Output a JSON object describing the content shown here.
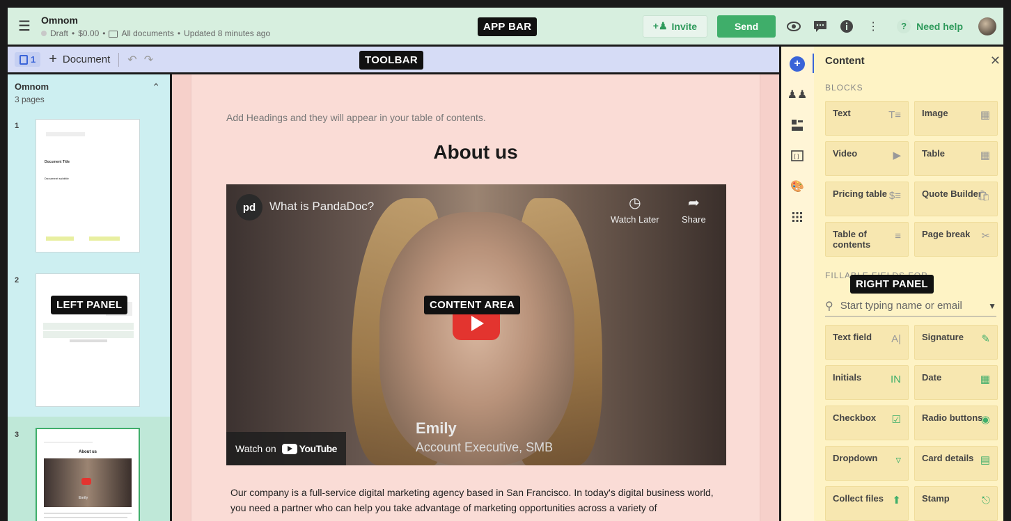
{
  "appbar": {
    "tag": "APP BAR",
    "doc_title": "Omnom",
    "status": "Draft",
    "price": "$0.00",
    "folder": "All documents",
    "updated": "Updated 8 minutes ago",
    "invite_label": "Invite",
    "send_label": "Send",
    "help_label": "Need help"
  },
  "toolbar": {
    "tag": "TOOLBAR",
    "pages_count": "1",
    "add_document_label": "Document"
  },
  "left_panel": {
    "tag": "LEFT PANEL",
    "title": "Omnom",
    "subtitle": "3 pages",
    "pages": [
      {
        "number": "1"
      },
      {
        "number": "2"
      },
      {
        "number": "3"
      }
    ],
    "thumb1": {
      "title": "Document Title",
      "subtitle": "Document subtitle"
    },
    "thumb3": {
      "heading": "About us",
      "person": "Emily"
    }
  },
  "content": {
    "tag": "CONTENT AREA",
    "toc_hint": "Add Headings and they will appear in your table of contents.",
    "heading": "About us",
    "video": {
      "channel_logo": "pd",
      "title": "What is PandaDoc?",
      "watch_later": "Watch Later",
      "share": "Share",
      "watch_on": "Watch on",
      "youtube": "YouTube",
      "person_name": "Emily",
      "person_role": "Account Executive, SMB"
    },
    "body": "Our company is a full-service digital marketing agency based in San Francisco. In today's digital business world, you need a partner who can help you take advantage of marketing opportunities across a variety of"
  },
  "right_panel": {
    "tag": "RIGHT PANEL",
    "header": "Content",
    "blocks_label": "BLOCKS",
    "blocks": [
      {
        "label": "Text",
        "icon": "text-icon"
      },
      {
        "label": "Image",
        "icon": "image-icon"
      },
      {
        "label": "Video",
        "icon": "video-icon"
      },
      {
        "label": "Table",
        "icon": "table-icon"
      },
      {
        "label": "Pricing table",
        "icon": "pricing-icon"
      },
      {
        "label": "Quote Builder",
        "icon": "quote-builder-icon"
      },
      {
        "label": "Table of contents",
        "icon": "toc-icon"
      },
      {
        "label": "Page break",
        "icon": "scissors-icon"
      }
    ],
    "fields_label": "FILLABLE FIELDS FOR",
    "search_placeholder": "Start typing name or email",
    "fields": [
      {
        "label": "Text field",
        "icon": "text-field-icon"
      },
      {
        "label": "Signature",
        "icon": "signature-icon"
      },
      {
        "label": "Initials",
        "icon": "initials-icon"
      },
      {
        "label": "Date",
        "icon": "calendar-icon"
      },
      {
        "label": "Checkbox",
        "icon": "checkbox-icon"
      },
      {
        "label": "Radio buttons",
        "icon": "radio-icon"
      },
      {
        "label": "Dropdown",
        "icon": "dropdown-icon"
      },
      {
        "label": "Card details",
        "icon": "card-icon"
      },
      {
        "label": "Collect files",
        "icon": "upload-icon"
      },
      {
        "label": "Stamp",
        "icon": "stamp-icon"
      }
    ]
  },
  "colors": {
    "appbar_bg": "#d7efdf",
    "toolbar_bg": "#d6dcf6",
    "left_panel_bg": "#cdeff1",
    "content_bg": "#f6d0ca",
    "right_panel_bg": "#fef3c5",
    "accent_green": "#3fae6a",
    "accent_blue": "#3a64d8"
  }
}
